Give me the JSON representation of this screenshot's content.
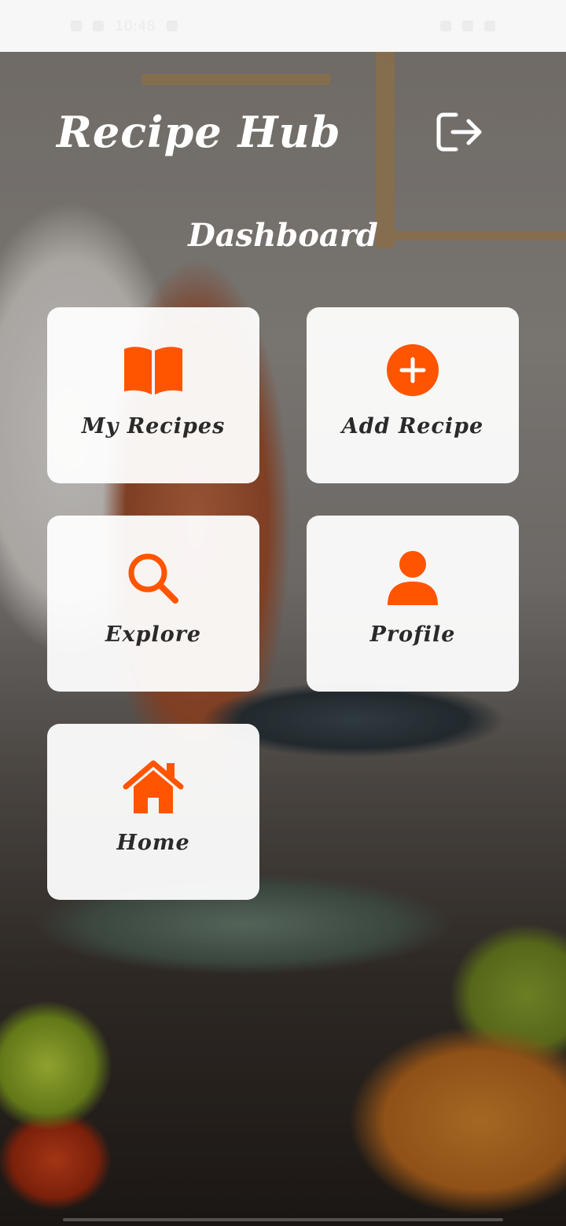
{
  "status_bar": {
    "time": "10:48"
  },
  "header": {
    "app_title": "Recipe Hub",
    "logout_icon": "logout-icon"
  },
  "page": {
    "heading": "Dashboard"
  },
  "colors": {
    "accent": "#FF5400",
    "card_background": "#FFFFFF",
    "label_text": "#2A2A2A"
  },
  "dashboard": {
    "cards": [
      {
        "label": "My Recipes",
        "icon": "book-icon"
      },
      {
        "label": "Add Recipe",
        "icon": "plus-circle-icon"
      },
      {
        "label": "Explore",
        "icon": "search-icon"
      },
      {
        "label": "Profile",
        "icon": "person-icon"
      },
      {
        "label": "Home",
        "icon": "home-icon"
      }
    ]
  }
}
